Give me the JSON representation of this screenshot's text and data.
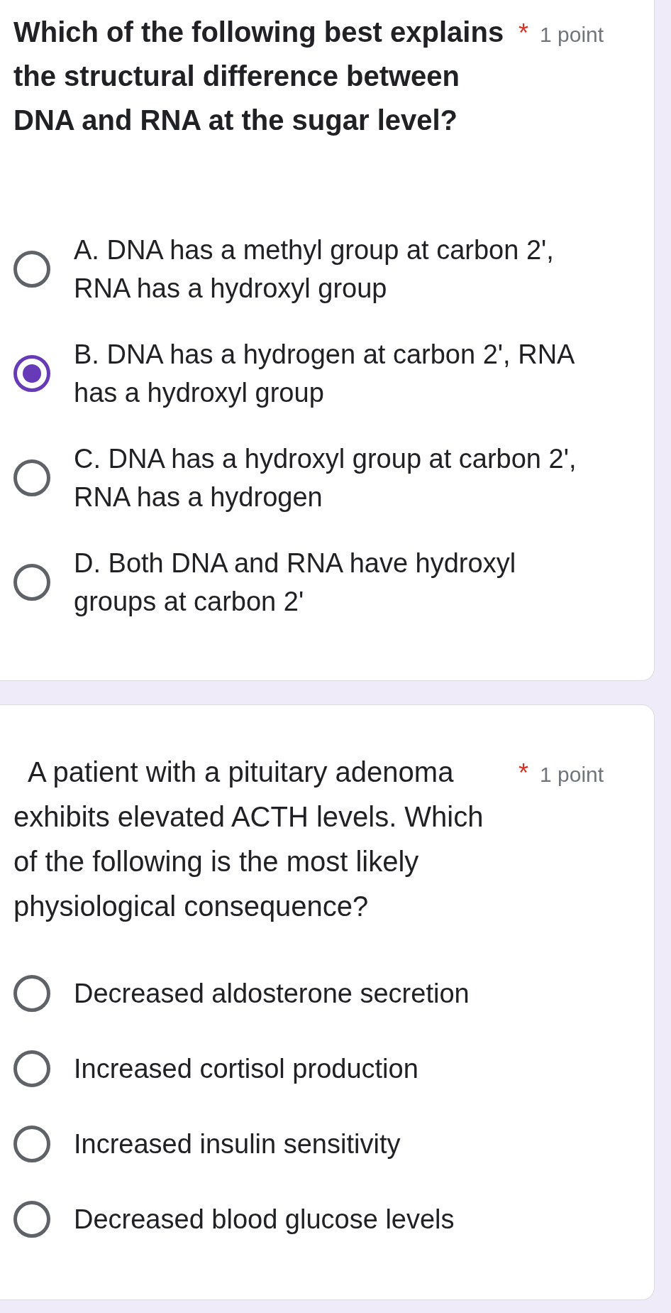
{
  "questions": [
    {
      "title": "Which of the following best explains the structural difference between DNA and RNA at the sugar level?",
      "kind": "emphasized",
      "required_mark": "*",
      "points": "1 point",
      "options": [
        {
          "label": "A. DNA has a methyl group at carbon 2', RNA has a hydroxyl group",
          "selected": false
        },
        {
          "label": "B. DNA has a hydrogen at carbon 2', RNA has a hydroxyl group",
          "selected": true
        },
        {
          "label": "C. DNA has a hydroxyl group at carbon 2', RNA has a hydrogen",
          "selected": false
        },
        {
          "label": "D. Both DNA and RNA have hydroxyl groups at carbon 2'",
          "selected": false
        }
      ]
    },
    {
      "title": "A patient with a pituitary adenoma exhibits elevated ACTH levels. Which of the following is the most likely physiological consequence?",
      "kind": "plain",
      "required_mark": "*",
      "points": "1 point",
      "options": [
        {
          "label": "Decreased aldosterone secretion",
          "selected": false
        },
        {
          "label": "Increased cortisol production",
          "selected": false
        },
        {
          "label": "Increased insulin sensitivity",
          "selected": false
        },
        {
          "label": "Decreased blood glucose levels",
          "selected": false
        }
      ]
    }
  ]
}
